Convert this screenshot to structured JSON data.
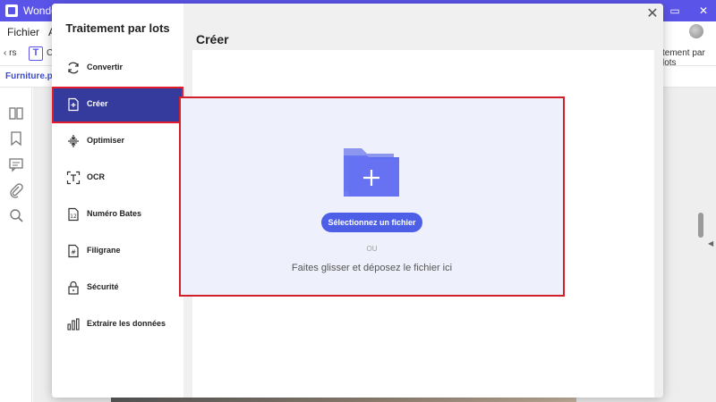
{
  "app": {
    "title": "Wonder",
    "window_controls": [
      "–",
      "▭",
      "✕"
    ]
  },
  "menubar": {
    "items": [
      "Fichier",
      "A"
    ]
  },
  "toolbar": {
    "left_text": "‹ rs",
    "t_label": "C",
    "right_text": "tement par lots"
  },
  "tabbar": {
    "file_tab": "Furniture.pdf"
  },
  "modal": {
    "heading": "Traitement par lots",
    "nav": [
      {
        "label": "Convertir",
        "icon": "refresh-icon"
      },
      {
        "label": "Créer",
        "icon": "add-file-icon",
        "active": true
      },
      {
        "label": "Optimiser",
        "icon": "compress-icon"
      },
      {
        "label": "OCR",
        "icon": "ocr-icon"
      },
      {
        "label": "Numéro Bates",
        "icon": "bates-number-icon"
      },
      {
        "label": "Filigrane",
        "icon": "watermark-icon"
      },
      {
        "label": "Sécurité",
        "icon": "lock-icon"
      },
      {
        "label": "Extraire les données",
        "icon": "chart-icon"
      }
    ],
    "main": {
      "title": "Créer",
      "select_button": "Sélectionnez un fichier",
      "or_text": "OU",
      "drop_text": "Faites glisser et déposez le fichier ici"
    },
    "close_icon": "close-icon"
  },
  "colors": {
    "titlebar": "#5b54e8",
    "active_nav": "#343b9c",
    "highlight_border": "#d31f2b",
    "button": "#4d5fe6",
    "dropzone_bg": "#eef0fc"
  }
}
